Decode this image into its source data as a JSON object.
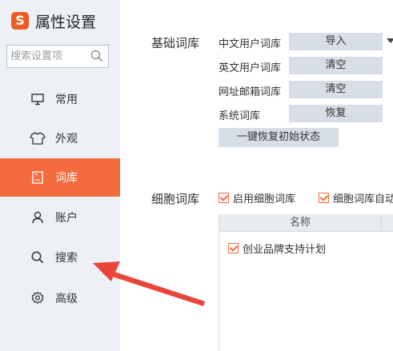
{
  "app": {
    "logo_letter": "S",
    "title": "属性设置"
  },
  "search": {
    "placeholder": "搜索设置项"
  },
  "sidebar": {
    "items": [
      {
        "label": "常用",
        "icon": "monitor-icon"
      },
      {
        "label": "外观",
        "icon": "shirt-icon"
      },
      {
        "label": "词库",
        "icon": "book-icon",
        "active": true
      },
      {
        "label": "账户",
        "icon": "user-icon"
      },
      {
        "label": "搜索",
        "icon": "search-icon"
      },
      {
        "label": "高级",
        "icon": "gear-icon"
      }
    ]
  },
  "dict": {
    "section_label": "基础词库",
    "rows": [
      {
        "label": "中文用户词库",
        "button": "导入",
        "has_dropdown": true
      },
      {
        "label": "英文用户词库",
        "button": "清空"
      },
      {
        "label": "网址邮箱词库",
        "button": "清空"
      },
      {
        "label": "系统词库",
        "button": "恢复"
      }
    ],
    "reset_button": "一键恢复初始状态"
  },
  "cell": {
    "section_label": "细胞词库",
    "enable_label": "启用细胞词库",
    "auto_label": "细胞词库自动",
    "table_header": "名称",
    "rows": [
      {
        "label": "创业品牌支持计划",
        "checked": true
      }
    ]
  },
  "colors": {
    "accent": "#f46b3e",
    "arrow": "#e8463b",
    "sidebar_bg": "#edf1f5"
  }
}
